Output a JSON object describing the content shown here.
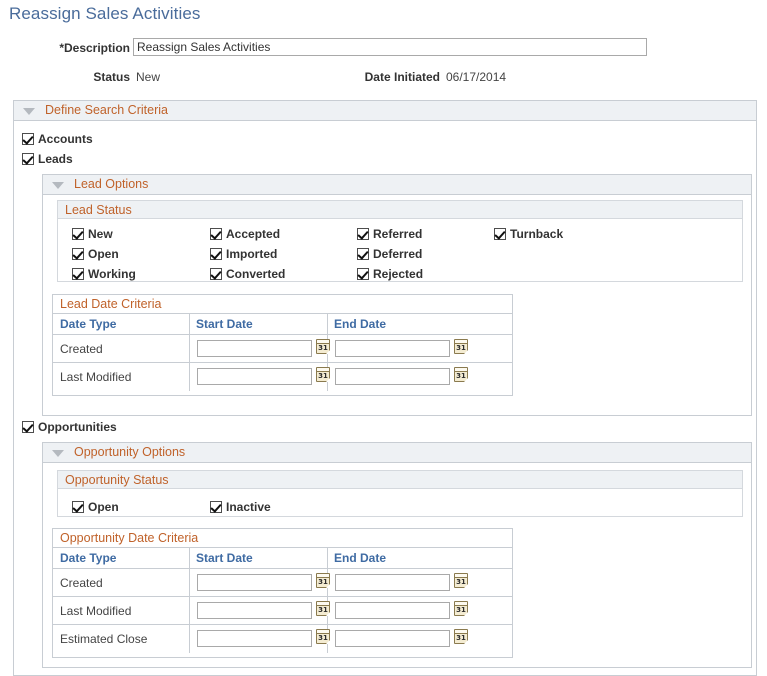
{
  "page": {
    "title": "Reassign Sales Activities"
  },
  "header": {
    "description_label": "*Description",
    "description_value": "Reassign Sales Activities",
    "description_placeholder": "",
    "status_label": "Status",
    "status_value": "New",
    "date_initiated_label": "Date Initiated",
    "date_initiated_value": "06/17/2014"
  },
  "define_search_criteria": {
    "header": "Define Search Criteria",
    "collapse_icon": "triangle-down-icon",
    "accounts": {
      "label": "Accounts",
      "checked": true
    },
    "leads": {
      "label": "Leads",
      "checked": true
    },
    "opportunities": {
      "label": "Opportunities",
      "checked": true
    }
  },
  "lead_options": {
    "header": "Lead Options",
    "collapse_icon": "triangle-down-icon",
    "lead_status": {
      "header": "Lead Status",
      "columns": [
        [
          "New",
          "Open",
          "Working"
        ],
        [
          "Accepted",
          "Imported",
          "Converted"
        ],
        [
          "Referred",
          "Deferred",
          "Rejected"
        ],
        [
          "Turnback"
        ]
      ],
      "all_checked": true
    },
    "lead_date_criteria": {
      "title": "Lead Date Criteria",
      "columns": [
        "Date Type",
        "Start Date",
        "End Date"
      ],
      "rows": [
        {
          "date_type": "Created",
          "start_date": "",
          "end_date": ""
        },
        {
          "date_type": "Last Modified",
          "start_date": "",
          "end_date": ""
        }
      ],
      "calendar_icon": "calendar-icon",
      "calendar_glyph": "31"
    }
  },
  "opportunity_options": {
    "header": "Opportunity Options",
    "collapse_icon": "triangle-down-icon",
    "opportunity_status": {
      "header": "Opportunity Status",
      "columns": [
        [
          "Open"
        ],
        [
          "Inactive"
        ]
      ],
      "all_checked": true
    },
    "opportunity_date_criteria": {
      "title": "Opportunity Date Criteria",
      "columns": [
        "Date Type",
        "Start Date",
        "End Date"
      ],
      "rows": [
        {
          "date_type": "Created",
          "start_date": "",
          "end_date": ""
        },
        {
          "date_type": "Last Modified",
          "start_date": "",
          "end_date": ""
        },
        {
          "date_type": "Estimated Close",
          "start_date": "",
          "end_date": ""
        }
      ],
      "calendar_icon": "calendar-icon",
      "calendar_glyph": "31"
    }
  },
  "colors": {
    "title_blue": "#4a6c9b",
    "section_header_orange": "#c0622a",
    "grid_header_blue": "#3f6ba3",
    "panel_bg": "#eef1f4",
    "border": "#c8cdd3"
  }
}
